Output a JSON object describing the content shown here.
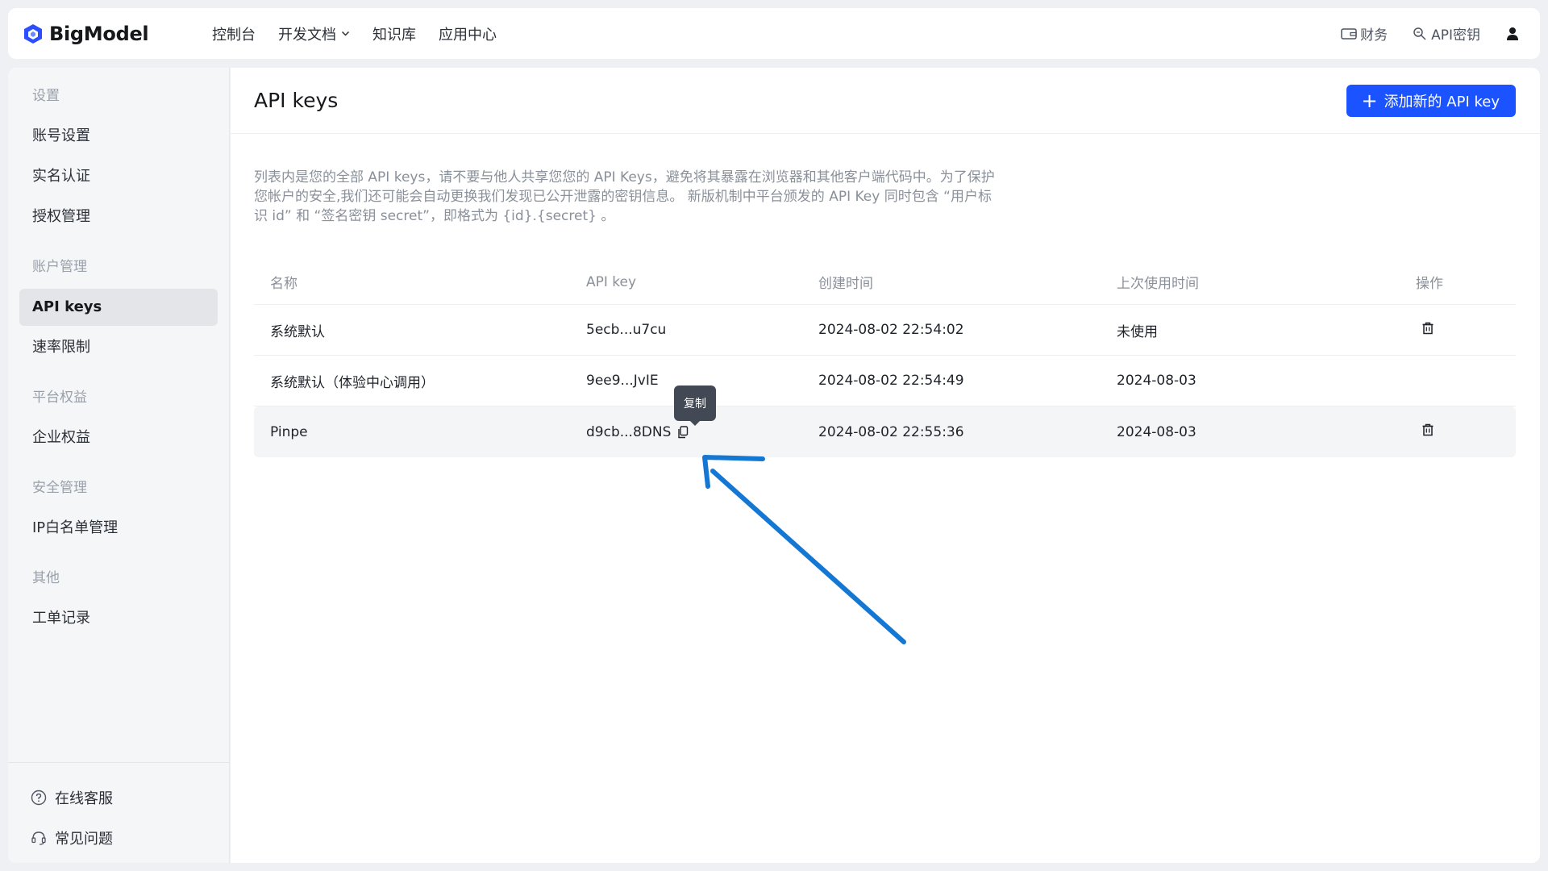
{
  "brand": {
    "name": "BigModel",
    "accent": "#1a53ff"
  },
  "nav": {
    "items": [
      {
        "label": "控制台"
      },
      {
        "label": "开发文档",
        "has_dropdown": true
      },
      {
        "label": "知识库"
      },
      {
        "label": "应用中心"
      }
    ],
    "finance_label": "财务",
    "apikey_label": "API密钥"
  },
  "sidebar": {
    "sections": [
      {
        "title": "设置",
        "items": [
          "账号设置",
          "实名认证",
          "授权管理"
        ]
      },
      {
        "title": "账户管理",
        "items": [
          "API keys",
          "速率限制"
        ],
        "active": "API keys"
      },
      {
        "title": "平台权益",
        "items": [
          "企业权益"
        ]
      },
      {
        "title": "安全管理",
        "items": [
          "IP白名单管理"
        ]
      },
      {
        "title": "其他",
        "items": [
          "工单记录"
        ]
      }
    ],
    "bottom": {
      "support": "在线客服",
      "faq": "常见问题"
    }
  },
  "main": {
    "title": "API keys",
    "add_button": "添加新的 API key",
    "description": "列表内是您的全部 API keys，请不要与他人共享您您的 API Keys，避免将其暴露在浏览器和其他客户端代码中。为了保护您帐户的安全,我们还可能会自动更换我们发现已公开泄露的密钥信息。 新版机制中平台颁发的 API Key 同时包含 “用户标识 id” 和 “签名密钥 secret”，即格式为 {id}.{secret} 。",
    "table": {
      "headers": [
        "名称",
        "API key",
        "创建时间",
        "上次使用时间",
        "操作"
      ],
      "rows": [
        {
          "name": "系统默认",
          "key": "5ecb...u7cu",
          "created": "2024-08-02 22:54:02",
          "last_used": "未使用"
        },
        {
          "name": "系统默认（体验中心调用）",
          "key": "9ee9...JvIE",
          "created": "2024-08-02 22:54:49",
          "last_used": "2024-08-03"
        },
        {
          "name": "Pinpe",
          "key": "d9cb...8DNS",
          "created": "2024-08-02 22:55:36",
          "last_used": "2024-08-03"
        }
      ]
    },
    "tooltip": "复制"
  }
}
